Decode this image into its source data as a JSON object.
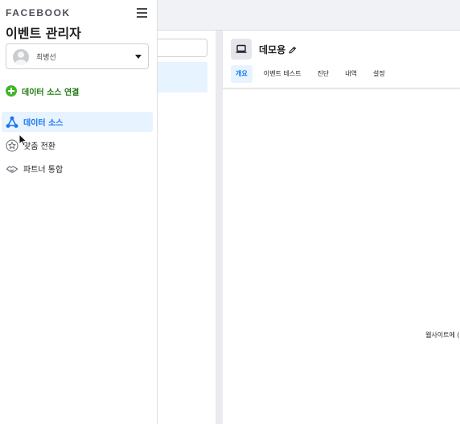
{
  "sidebar": {
    "brand": "FACEBOOK",
    "title": "이벤트 관리자",
    "account": {
      "name": "최병선"
    },
    "connect_label": "데이터 소스 연결",
    "items": [
      {
        "label": "데이터 소스",
        "icon": "data-source-icon",
        "active": true
      },
      {
        "label": "맞춤 전환",
        "icon": "star-icon",
        "active": false
      },
      {
        "label": "파트너 통합",
        "icon": "handshake-icon",
        "active": false
      }
    ]
  },
  "main": {
    "source_title": "데모용",
    "tabs": [
      {
        "label": "개요",
        "active": true
      },
      {
        "label": "이벤트 테스트",
        "active": false
      },
      {
        "label": "진단",
        "active": false
      },
      {
        "label": "내역",
        "active": false
      },
      {
        "label": "설정",
        "active": false
      }
    ],
    "body_text": "웹사이트에 ("
  },
  "colors": {
    "accent": "#1877f2",
    "active_bg": "#e7f3ff",
    "connect_green": "#42b72a"
  }
}
